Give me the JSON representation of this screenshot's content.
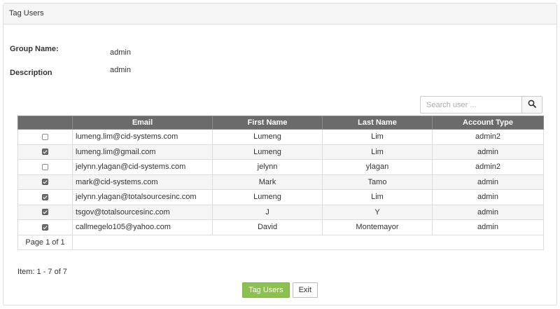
{
  "panel": {
    "title": "Tag Users"
  },
  "group": {
    "name_label": "Group Name:",
    "name_value": "admin",
    "description_label": "Description",
    "description_value": "admin"
  },
  "search": {
    "placeholder": "Search user ...",
    "icon": "search-icon"
  },
  "table": {
    "columns": [
      "",
      "Email",
      "First Name",
      "Last Name",
      "Account Type"
    ],
    "rows": [
      {
        "checked": false,
        "email": "lumeng.lim@cid-systems.com",
        "first_name": "Lumeng",
        "last_name": "Lim",
        "account_type": "admin2"
      },
      {
        "checked": true,
        "email": "lumeng.lim@gmail.com",
        "first_name": "Lumeng",
        "last_name": "Lim",
        "account_type": "admin"
      },
      {
        "checked": false,
        "email": "jelynn.ylagan@cid-systems.com",
        "first_name": "jelynn",
        "last_name": "ylagan",
        "account_type": "admin2"
      },
      {
        "checked": true,
        "email": "mark@cid-systems.com",
        "first_name": "Mark",
        "last_name": "Tamo",
        "account_type": "admin"
      },
      {
        "checked": true,
        "email": "jelynn.ylagan@totalsourcesinc.com",
        "first_name": "Lumeng",
        "last_name": "Lim",
        "account_type": "admin"
      },
      {
        "checked": true,
        "email": "tsgov@totalsourcesinc.com",
        "first_name": "J",
        "last_name": "Y",
        "account_type": "admin"
      },
      {
        "checked": true,
        "email": "callmegelo105@yahoo.com",
        "first_name": "David",
        "last_name": "Montemayor",
        "account_type": "admin"
      }
    ],
    "pager": "Page 1 of 1"
  },
  "item_count": "Item: 1 - 7 of 7",
  "buttons": {
    "tag_users": "Tag Users",
    "exit": "Exit"
  },
  "colors": {
    "header_bg": "#6b6b6b",
    "primary_button": "#8cc152"
  }
}
